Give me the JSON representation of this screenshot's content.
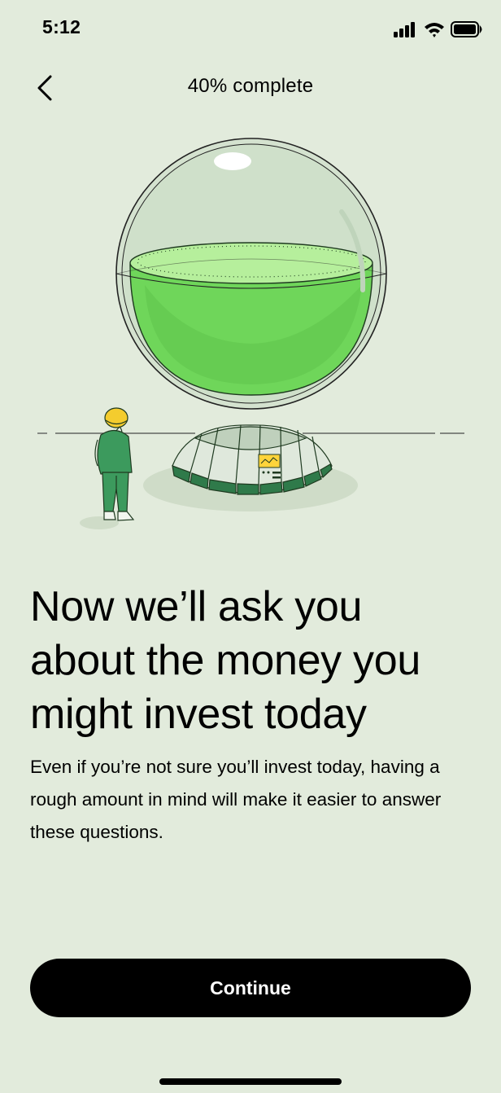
{
  "status_bar": {
    "time": "5:12",
    "icons": [
      "cellular-signal-icon",
      "wifi-icon",
      "battery-icon"
    ]
  },
  "nav": {
    "back_icon": "chevron-left-icon",
    "progress_label": "40% complete"
  },
  "illustration": {
    "description_icon": "glass-sphere-with-green-liquid-illustration"
  },
  "content": {
    "headline": "Now we’ll ask you about the money you might invest today",
    "body": "Even if you’re not sure you’ll invest today, having a rough amount in mind will make it easier to answer these questions."
  },
  "actions": {
    "continue_label": "Continue"
  },
  "colors": {
    "background": "#e2ebdc",
    "accent_green": "#7ee462",
    "dark_green": "#2f7a4a",
    "button": "#000000"
  }
}
